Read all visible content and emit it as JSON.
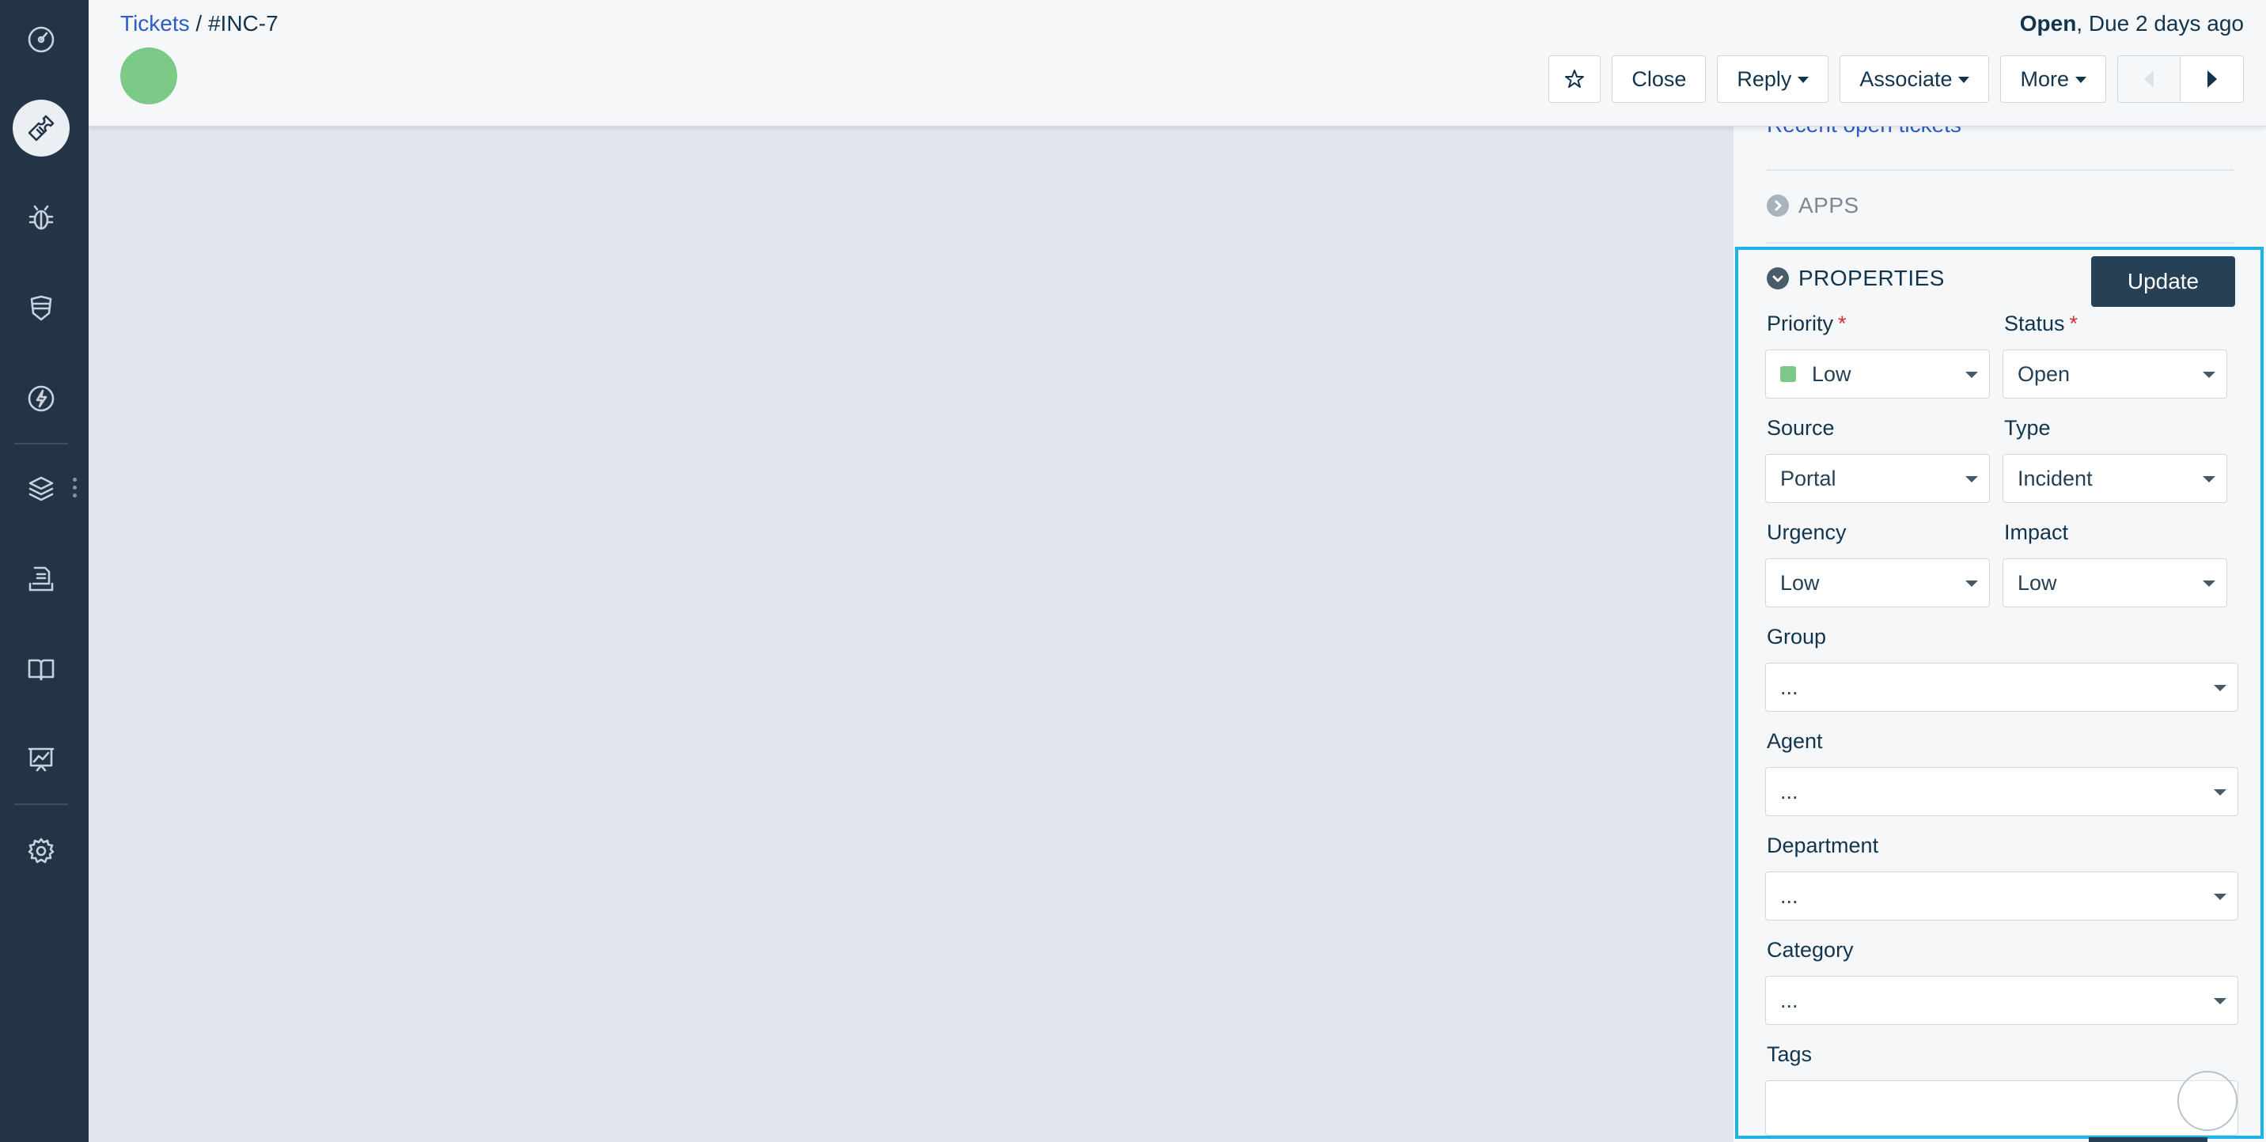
{
  "sidebar": {
    "items": [
      {
        "icon": "dashboard-icon",
        "active": false
      },
      {
        "icon": "ticket-icon",
        "active": true
      },
      {
        "icon": "bug-icon",
        "active": false
      },
      {
        "icon": "shield-icon",
        "active": false
      },
      {
        "icon": "bolt-icon",
        "active": false
      },
      {
        "icon": "layers-icon",
        "active": false
      },
      {
        "icon": "inbox-document-icon",
        "active": false
      },
      {
        "icon": "book-icon",
        "active": false
      },
      {
        "icon": "analytics-icon",
        "active": false
      },
      {
        "icon": "gear-icon",
        "active": false
      }
    ]
  },
  "header": {
    "breadcrumb_link": "Tickets",
    "breadcrumb_separator": " / ",
    "ticket_id": "#INC-7",
    "status": "Open",
    "due_text": ", Due 2 days ago",
    "buttons": {
      "star_icon": "star-icon",
      "close": "Close",
      "reply": "Reply",
      "associate": "Associate",
      "more": "More"
    }
  },
  "panel": {
    "recent_link": "Recent open tickets",
    "apps_title": "APPS",
    "properties_title": "PROPERTIES",
    "update_label": "Update",
    "fields": {
      "priority": {
        "label": "Priority",
        "required": "*",
        "value": "Low",
        "swatch_color": "#7dc987"
      },
      "status": {
        "label": "Status",
        "required": "*",
        "value": "Open"
      },
      "source": {
        "label": "Source",
        "value": "Portal"
      },
      "type": {
        "label": "Type",
        "value": "Incident"
      },
      "urgency": {
        "label": "Urgency",
        "value": "Low"
      },
      "impact": {
        "label": "Impact",
        "value": "Low"
      },
      "group": {
        "label": "Group",
        "value": "..."
      },
      "agent": {
        "label": "Agent",
        "value": "..."
      },
      "department": {
        "label": "Department",
        "value": "..."
      },
      "category": {
        "label": "Category",
        "value": "..."
      },
      "tags": {
        "label": "Tags",
        "value": ""
      }
    }
  },
  "colors": {
    "sidebar_bg": "#233446",
    "accent_highlight": "#1fb4e8",
    "link": "#2c5cc5",
    "primary_button": "#264055"
  }
}
